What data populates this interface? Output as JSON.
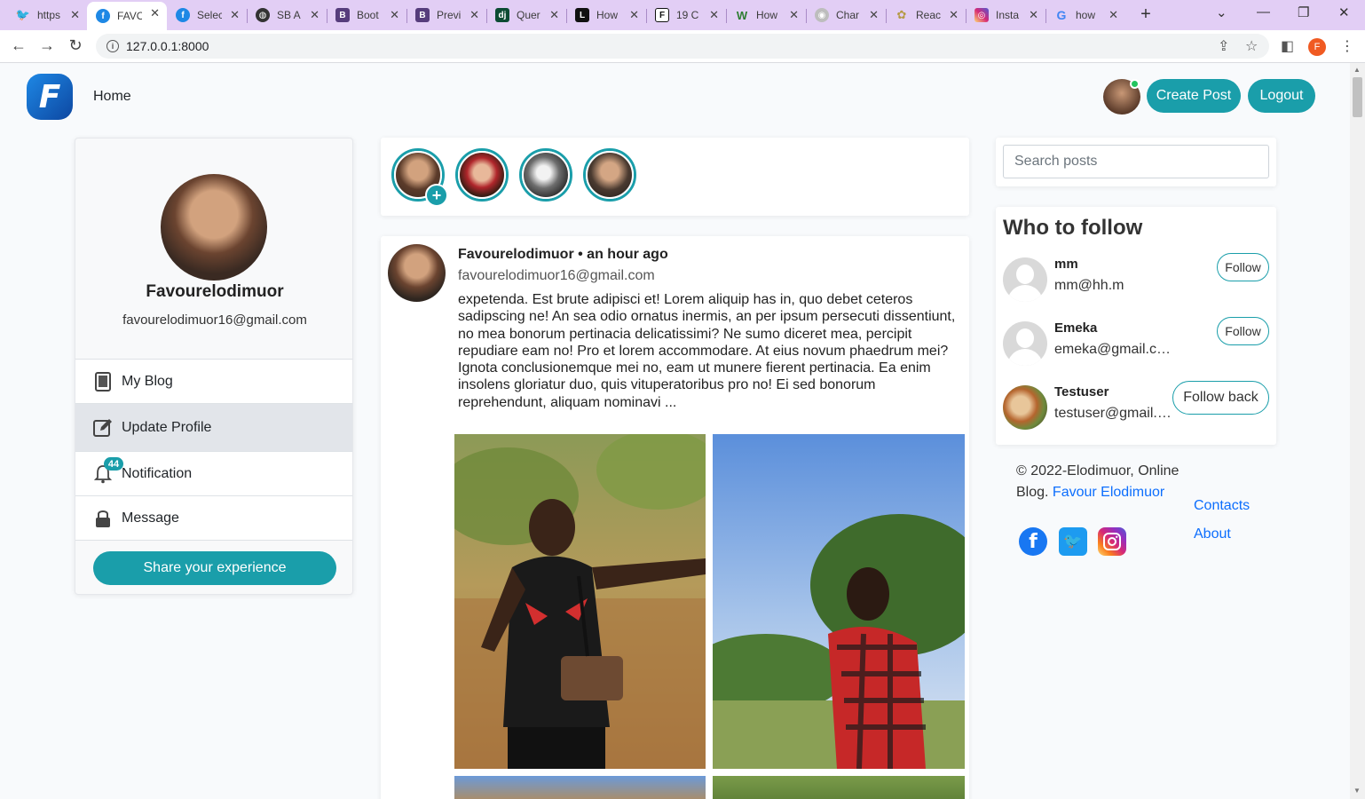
{
  "browser": {
    "tabs": [
      {
        "title": "https",
        "favicon": "twitter-icon",
        "color": "#1d9bf0"
      },
      {
        "title": "FAVO",
        "favicon": "site-logo-icon",
        "color": "#1e88e5",
        "active": true
      },
      {
        "title": "Selec",
        "favicon": "site-logo-icon",
        "color": "#1e88e5"
      },
      {
        "title": "SB A",
        "favicon": "globe-icon",
        "color": "#333333"
      },
      {
        "title": "Boot",
        "favicon": "bootstrap-icon",
        "color": "#563d7c"
      },
      {
        "title": "Previ",
        "favicon": "bootstrap-icon",
        "color": "#563d7c"
      },
      {
        "title": "Quer",
        "favicon": "django-icon",
        "color": "#0c4b33"
      },
      {
        "title": "How",
        "favicon": "letter-l-icon",
        "color": "#111111"
      },
      {
        "title": "19 C",
        "favicon": "letter-f-icon",
        "color": "#111111"
      },
      {
        "title": "How",
        "favicon": "w-icon",
        "color": "#2e7d32"
      },
      {
        "title": "Char",
        "favicon": "github-icon",
        "color": "#bdbdbd"
      },
      {
        "title": "Reac",
        "favicon": "flower-icon",
        "color": "#e5d7a8"
      },
      {
        "title": "Insta",
        "favicon": "instagram-icon",
        "color": "#d62976"
      },
      {
        "title": "how",
        "favicon": "google-icon",
        "color": "#4285f4"
      }
    ],
    "url": "127.0.0.1:8000",
    "profile_initial": "F"
  },
  "navbar": {
    "home_label": "Home",
    "create_post_label": "Create Post",
    "logout_label": "Logout"
  },
  "profile": {
    "name": "Favourelodimuor",
    "email": "favourelodimuor16@gmail.com",
    "menu": [
      {
        "label": "My Blog",
        "icon": "document-icon"
      },
      {
        "label": "Update Profile",
        "icon": "edit-icon",
        "active": true
      },
      {
        "label": "Notification",
        "icon": "bell-icon",
        "badge": "44"
      },
      {
        "label": "Message",
        "icon": "lock-icon"
      }
    ],
    "share_label": "Share your experience"
  },
  "post": {
    "author_line": "Favourelodimuor • an hour ago",
    "email": "favourelodimuor16@gmail.com",
    "body": "expetenda. Est brute adipisci et! Lorem aliquip has in, quo debet ceteros sadipscing ne! An sea odio ornatus inermis, an per ipsum persecuti dissentiunt, no mea bonorum pertinacia delicatissimi? Ne sumo diceret mea, percipit repudiare eam no! Pro et lorem accommodare. At eius novum phaedrum mei? Ignota conclusionemque mei no, eam ut munere fierent pertinacia. Ea enim insolens gloriatur duo, quis vituperatoribus pro no! Ei sed bonorum reprehendunt, aliquam nominavi ..."
  },
  "search": {
    "placeholder": "Search posts"
  },
  "who_to_follow": {
    "title": "Who to follow",
    "users": [
      {
        "name": "mm",
        "email": "mm@hh.m",
        "button": "Follow"
      },
      {
        "name": "Emeka",
        "email": "emeka@gmail.cdom",
        "button": "Follow"
      },
      {
        "name": "Testuser",
        "email": "testuser@gmail.com",
        "button": "Follow back"
      }
    ]
  },
  "footer": {
    "copyright": "© 2022-Elodimuor, Online Blog.",
    "author_link": "Favour Elodimuor",
    "contacts_label": "Contacts",
    "about_label": "About"
  }
}
